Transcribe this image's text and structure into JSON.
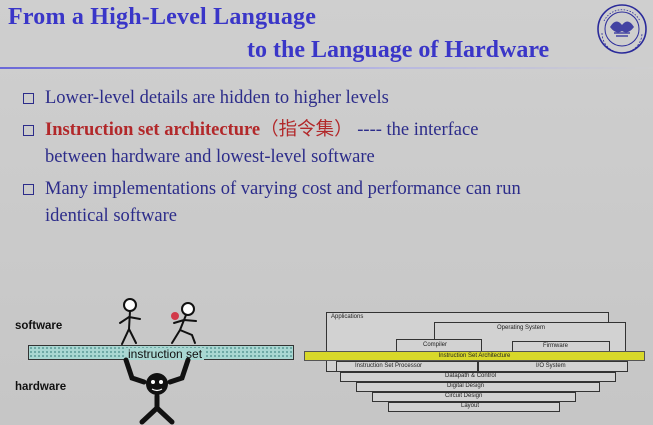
{
  "title": {
    "line1": "From a High-Level Language",
    "line2": "to the Language of Hardware"
  },
  "bullets": [
    {
      "line1": "Lower-level details are hidden to higher levels"
    },
    {
      "highlight": "Instruction set architecture",
      "chinese": "（指令集）",
      "rest": " ---- the interface",
      "line2": "between hardware and lowest-level software"
    },
    {
      "line1": "Many implementations of varying cost and performance can run",
      "line2": "identical software"
    }
  ],
  "figure_left": {
    "software_label": "software",
    "hardware_label": "hardware",
    "bar_label": "instruction set"
  },
  "figure_right": {
    "applications": "Applications",
    "operating_system": "Operating System",
    "compiler": "Compiler",
    "firmware": "Firmware",
    "isa": "Instruction Set Architecture",
    "isp": "Instruction Set Processor",
    "io": "I/O System",
    "datapath": "Datapath & Control",
    "digital": "Digital Design",
    "circuit": "Circuit Design",
    "layout": "Layout"
  },
  "colors": {
    "title": "#3a36c8",
    "text": "#2c2c8a",
    "highlight": "#b2282a",
    "isa_band": "#d8d82a",
    "bar": "#a9d7d2"
  },
  "logo": {
    "icon": "university-seal-icon",
    "text": "ZHEJIANG UNIVERSITY"
  }
}
